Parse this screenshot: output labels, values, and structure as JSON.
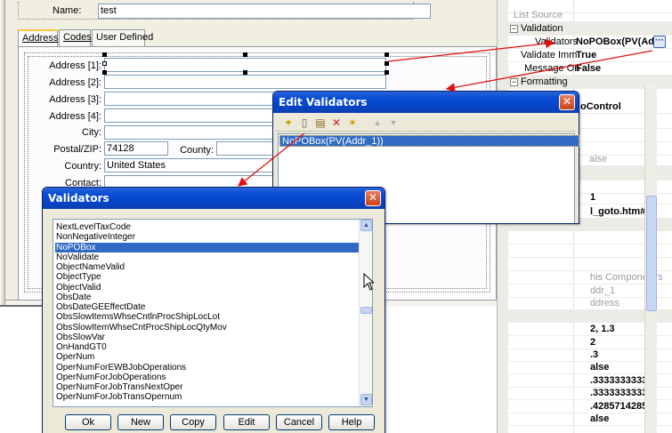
{
  "form": {
    "name_label": "Name:",
    "name_value": "test",
    "tabs": [
      "Address",
      "Codes",
      "User Defined"
    ],
    "fields": {
      "address1": "Address [1]:",
      "address2": "Address [2]:",
      "address3": "Address [3]:",
      "address4": "Address [4]:",
      "city": "City:",
      "postal": "Postal/ZIP:",
      "postal_value": "74128",
      "county": "County:",
      "country": "Country:",
      "country_value": "United States",
      "contact": "Contact:"
    }
  },
  "props": {
    "rows": [
      {
        "name": "List Source",
        "value": "",
        "kind": "gray"
      },
      {
        "name": "Validation",
        "kind": "category"
      },
      {
        "name": "Validators",
        "value": "NoPOBox(PV(Ad",
        "kind": "prop"
      },
      {
        "name": "Validate Imm",
        "value": "True",
        "kind": "prop"
      },
      {
        "name": "Message On",
        "value": "False",
        "kind": "prop"
      },
      {
        "name": "Formatting",
        "kind": "category"
      }
    ],
    "partial_values": [
      "oControl",
      "alse",
      "1",
      "l_goto.htm#F",
      "his Component's",
      "ddr_1",
      "ddress",
      "2, 1.3",
      "2",
      ".3",
      "alse",
      ".33333333333",
      ".33333333333",
      ".42857142857",
      "alse"
    ],
    "ellipsis": "···"
  },
  "edit_validators": {
    "title": "Edit Validators",
    "entries": [
      "NoPOBox(PV(Addr_1))"
    ]
  },
  "validators": {
    "title": "Validators",
    "items": [
      "NextLevelTaxCode",
      "NonNegativeInteger",
      "NoPOBox",
      "NoValidate",
      "ObjectNameValid",
      "ObjectType",
      "ObjectValid",
      "ObsDate",
      "ObsDateGEEffectDate",
      "ObsSlowItemsWhseCntlnProcShipLocLot",
      "ObsSlowItemWhseCntProcShipLocQtyMov",
      "ObsSlowVar",
      "OnHandGT0",
      "OperNum",
      "OperNumForEWBJobOperations",
      "OperNumForJobOperations",
      "OperNumForJobTransNextOper",
      "OperNumForJobTransOpernum"
    ],
    "selected_index": 2,
    "buttons": {
      "ok": "Ok",
      "new": "New",
      "copy": "Copy",
      "edit": "Edit",
      "cancel": "Cancel",
      "help": "Help"
    }
  },
  "colors": {
    "accent": "#316ac5",
    "arrow": "#e01010",
    "title_bar": "#0a4ed6"
  }
}
